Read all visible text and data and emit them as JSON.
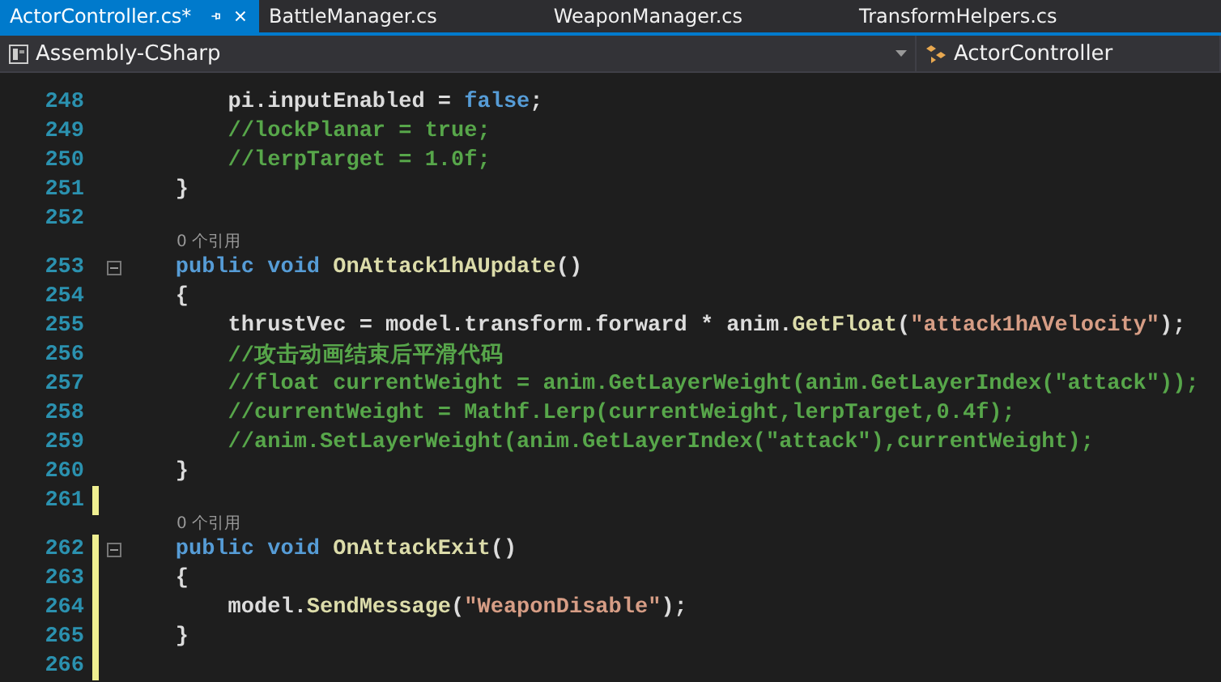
{
  "tabs": [
    {
      "label": "ActorController.cs*",
      "selected": true
    },
    {
      "label": "BattleManager.cs",
      "selected": false
    },
    {
      "label": "WeaponManager.cs",
      "selected": false
    },
    {
      "label": "TransformHelpers.cs",
      "selected": false
    }
  ],
  "navigation_bar": {
    "project": "Assembly-CSharp",
    "type": "ActorController"
  },
  "editor": {
    "lines": [
      {
        "kind": "code",
        "number": "248",
        "changed": false,
        "fold": false,
        "tokens": [
          {
            "kind": "plain",
            "text": "        pi.inputEnabled = "
          },
          {
            "kind": "keyword",
            "text": "false"
          },
          {
            "kind": "plain",
            "text": ";"
          }
        ]
      },
      {
        "kind": "code",
        "number": "249",
        "changed": false,
        "fold": false,
        "tokens": [
          {
            "kind": "comment",
            "text": "        //lockPlanar = true;"
          }
        ]
      },
      {
        "kind": "code",
        "number": "250",
        "changed": false,
        "fold": false,
        "tokens": [
          {
            "kind": "comment",
            "text": "        //lerpTarget = 1.0f;"
          }
        ]
      },
      {
        "kind": "code",
        "number": "251",
        "changed": false,
        "fold": false,
        "tokens": [
          {
            "kind": "plain",
            "text": "    }"
          }
        ]
      },
      {
        "kind": "code",
        "number": "252",
        "changed": false,
        "fold": false
      },
      {
        "kind": "codelens",
        "text": "0 个引用"
      },
      {
        "kind": "code",
        "number": "253",
        "changed": false,
        "fold": true,
        "tokens": [
          {
            "kind": "keyword",
            "text": "    public void "
          },
          {
            "kind": "method",
            "text": "OnAttack1hAUpdate"
          },
          {
            "kind": "plain",
            "text": "()"
          }
        ]
      },
      {
        "kind": "code",
        "number": "254",
        "changed": false,
        "fold": false,
        "tokens": [
          {
            "kind": "plain",
            "text": "    {"
          }
        ]
      },
      {
        "kind": "code",
        "number": "255",
        "changed": false,
        "fold": false,
        "tokens": [
          {
            "kind": "plain",
            "text": "        thrustVec = model.transform.forward * anim."
          },
          {
            "kind": "method",
            "text": "GetFloat"
          },
          {
            "kind": "plain",
            "text": "("
          },
          {
            "kind": "string",
            "text": "\"attack1hAVelocity\""
          },
          {
            "kind": "plain",
            "text": ");"
          }
        ]
      },
      {
        "kind": "code",
        "number": "256",
        "changed": false,
        "fold": false,
        "tokens": [
          {
            "kind": "comment",
            "text": "        //攻击动画结束后平滑代码"
          }
        ]
      },
      {
        "kind": "code",
        "number": "257",
        "changed": false,
        "fold": false,
        "tokens": [
          {
            "kind": "comment",
            "text": "        //float currentWeight = anim.GetLayerWeight(anim.GetLayerIndex(\"attack\"));"
          }
        ]
      },
      {
        "kind": "code",
        "number": "258",
        "changed": false,
        "fold": false,
        "tokens": [
          {
            "kind": "comment",
            "text": "        //currentWeight = Mathf.Lerp(currentWeight,lerpTarget,0.4f);"
          }
        ]
      },
      {
        "kind": "code",
        "number": "259",
        "changed": false,
        "fold": false,
        "tokens": [
          {
            "kind": "comment",
            "text": "        //anim.SetLayerWeight(anim.GetLayerIndex(\"attack\"),currentWeight);"
          }
        ]
      },
      {
        "kind": "code",
        "number": "260",
        "changed": false,
        "fold": false,
        "tokens": [
          {
            "kind": "plain",
            "text": "    }"
          }
        ]
      },
      {
        "kind": "code",
        "number": "261",
        "changed": true,
        "fold": false
      },
      {
        "kind": "codelens",
        "text": "0 个引用"
      },
      {
        "kind": "code",
        "number": "262",
        "changed": true,
        "fold": true,
        "tokens": [
          {
            "kind": "keyword",
            "text": "    public void "
          },
          {
            "kind": "method",
            "text": "OnAttackExit"
          },
          {
            "kind": "plain",
            "text": "()"
          }
        ]
      },
      {
        "kind": "code",
        "number": "263",
        "changed": true,
        "fold": false,
        "tokens": [
          {
            "kind": "plain",
            "text": "    {"
          }
        ]
      },
      {
        "kind": "code",
        "number": "264",
        "changed": true,
        "fold": false,
        "tokens": [
          {
            "kind": "plain",
            "text": "        model."
          },
          {
            "kind": "method",
            "text": "SendMessage"
          },
          {
            "kind": "plain",
            "text": "("
          },
          {
            "kind": "string",
            "text": "\"WeaponDisable\""
          },
          {
            "kind": "plain",
            "text": ");"
          }
        ]
      },
      {
        "kind": "code",
        "number": "265",
        "changed": true,
        "fold": false,
        "tokens": [
          {
            "kind": "plain",
            "text": "    }"
          }
        ]
      },
      {
        "kind": "code",
        "number": "266",
        "changed": true,
        "fold": false
      }
    ]
  }
}
